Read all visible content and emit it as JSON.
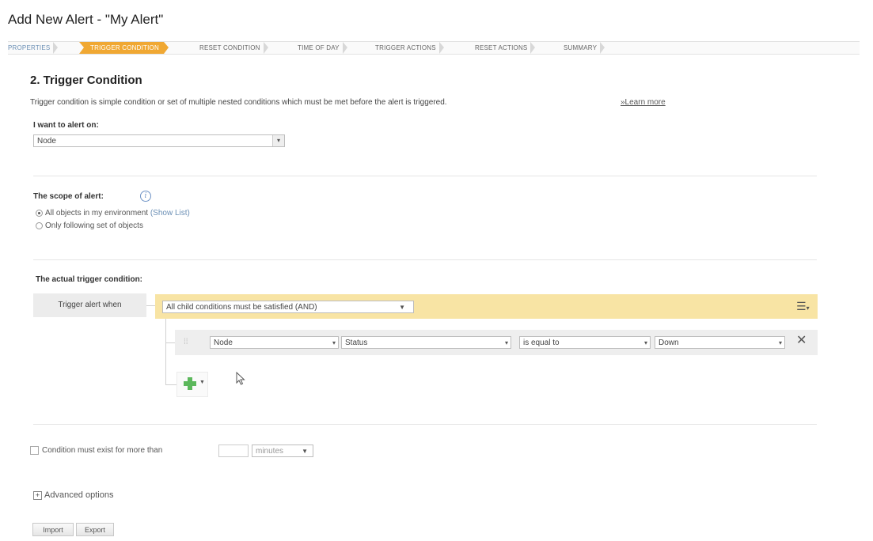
{
  "page": {
    "title": "Add New Alert - \"My Alert\""
  },
  "wizard": {
    "steps": [
      "PROPERTIES",
      "TRIGGER CONDITION",
      "RESET CONDITION",
      "TIME OF DAY",
      "TRIGGER ACTIONS",
      "RESET ACTIONS",
      "SUMMARY"
    ],
    "active_step": "TRIGGER CONDITION",
    "accent_color": "#f0a833"
  },
  "section": {
    "heading": "2. Trigger Condition",
    "description": "Trigger condition is simple condition or set of multiple nested conditions which must be met before the alert is triggered.",
    "learn_more": "»Learn more"
  },
  "alert_on": {
    "label": "I want to alert on:",
    "value": "Node"
  },
  "scope": {
    "label": "The scope of alert:",
    "option_all": "All objects in my environment",
    "show_list": "(Show List)",
    "option_following": "Only following set of objects",
    "selected": "all"
  },
  "trigger": {
    "label": "The actual trigger condition:",
    "when_label": "Trigger alert when",
    "group_operator": "All child conditions must be satisfied (AND)",
    "group_color": "#f8e4a4",
    "condition": {
      "object": "Node",
      "field": "Status",
      "operator": "is equal to",
      "value": "Down"
    }
  },
  "duration": {
    "label": "Condition must exist for more than",
    "value": "",
    "unit": "minutes"
  },
  "advanced": {
    "label": "Advanced options"
  },
  "buttons": {
    "import": "Import",
    "export": "Export"
  },
  "icons": {
    "info": "info-icon",
    "menu": "hamburger-menu-icon",
    "remove": "close-icon",
    "add": "green-plus-icon",
    "expand": "expand-plus-icon",
    "cursor": "mouse-pointer-icon"
  }
}
